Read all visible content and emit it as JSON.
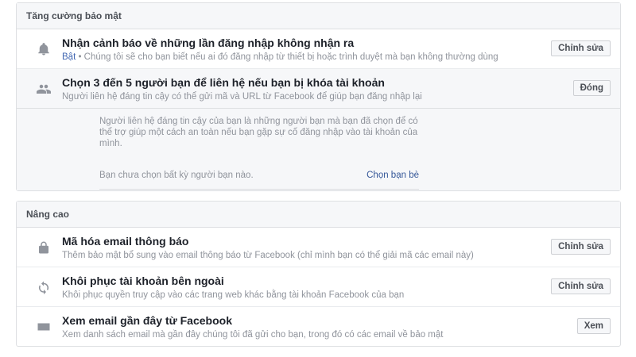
{
  "security": {
    "header": "Tăng cường bảo mật",
    "login_alerts": {
      "title": "Nhận cảnh báo về những lần đăng nhập không nhận ra",
      "status": "Bật",
      "desc": " • Chúng tôi sẽ cho bạn biết nếu ai đó đăng nhập từ thiết bị hoặc trình duyệt mà bạn không thường dùng",
      "button": "Chỉnh sửa",
      "icon": "bell-icon"
    },
    "trusted_contacts": {
      "title": "Chọn 3 đến 5 người bạn để liên hệ nếu bạn bị khóa tài khoản",
      "desc": "Người liên hệ đáng tin cậy có thể gửi mã và URL từ Facebook để giúp bạn đăng nhập lại",
      "button": "Đóng",
      "icon": "friends-icon",
      "expanded_text": "Người liên hệ đáng tin cậy của bạn là những người bạn mà bạn đã chọn để có thể trợ giúp một cách an toàn nếu bạn gặp sự cố đăng nhập vào tài khoản của mình.",
      "no_friends": "Bạn chưa chọn bất kỳ người bạn nào.",
      "choose_link": "Chọn bạn bè"
    }
  },
  "advanced": {
    "header": "Nâng cao",
    "encrypt_email": {
      "title": "Mã hóa email thông báo",
      "desc": "Thêm bảo mật bổ sung vào email thông báo từ Facebook (chỉ mình bạn có thể giải mã các email này)",
      "button": "Chỉnh sửa",
      "icon": "lock-icon"
    },
    "recover_external": {
      "title": "Khôi phục tài khoản bên ngoài",
      "desc": "Khôi phục quyền truy cập vào các trang web khác bằng tài khoản Facebook của bạn",
      "button": "Chỉnh sửa",
      "icon": "refresh-icon"
    },
    "recent_emails": {
      "title": "Xem email gần đây từ Facebook",
      "desc": "Xem danh sách email mà gần đây chúng tôi đã gửi cho bạn, trong đó có các email về bảo mật",
      "button": "Xem",
      "icon": "envelope-icon"
    }
  },
  "colors": {
    "link": "#365899",
    "status_on": "#4267b2",
    "panel_header_bg": "#f6f7f9",
    "border": "#dddfe2"
  }
}
